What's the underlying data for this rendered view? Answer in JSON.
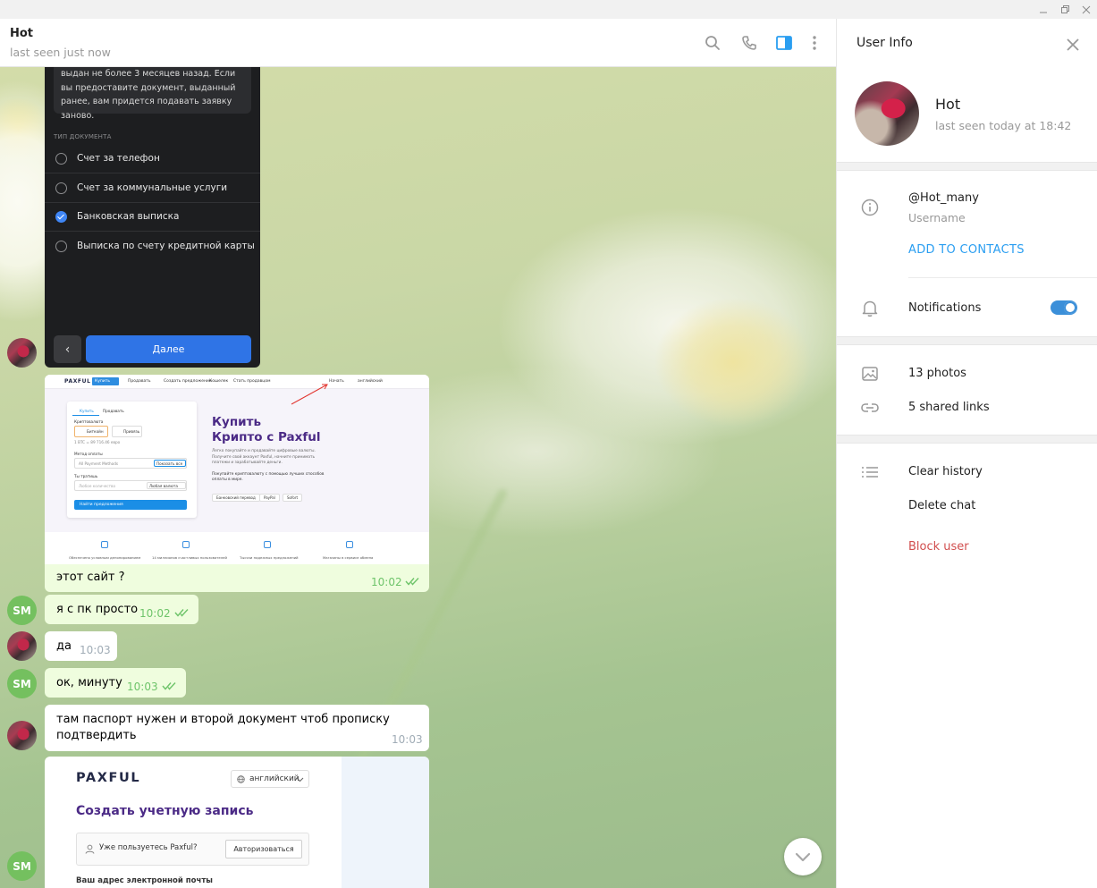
{
  "header": {
    "chat_title": "Hot",
    "chat_status": "last seen just now"
  },
  "dark_form": {
    "notice": "выдан не более 3 месяцев назад. Если вы предоставите документ, выданный ранее, вам придется подавать заявку заново.",
    "section_label": "ТИП ДОКУМЕНТА",
    "options": [
      {
        "label": "Счет за телефон",
        "selected": false
      },
      {
        "label": "Счет за коммунальные услуги",
        "selected": false
      },
      {
        "label": "Банковская выписка",
        "selected": true
      },
      {
        "label": "Выписка по счету кредитной карты",
        "selected": false
      }
    ],
    "back_glyph": "‹",
    "next_label": "Далее"
  },
  "paxful_landing": {
    "logo": "PAXFUL",
    "nav": {
      "buy": "Купить",
      "sell": "Продавать",
      "create_offer": "Создать предложение",
      "wallet": "Кошелек",
      "become_seller": "Стать продавцом",
      "start": "Начать",
      "lang": "английский"
    },
    "card": {
      "tab_buy": "Купить",
      "tab_sell": "Продавать",
      "crypto_label": "Криптовалюта",
      "coin_btc": "Биткойн",
      "coin_usdt": "Привязь",
      "rate": "1 BTC = 89 716.46 евро",
      "method_label": "Метод оплаты",
      "method_value": "All Payment Methods",
      "show_all": "Показать все",
      "amount_label": "Ты тратишь",
      "amount_placeholder": "Любое количество",
      "currency": "Любая валюта",
      "find_btn": "Найти предложения"
    },
    "headline_1": "Купить",
    "headline_2": "Крипто с Paxful",
    "desc": "Легко покупайте и продавайте цифровые валюты. Получите свой аккаунт Paxful, начните принимать платежи и зарабатывайте деньги.",
    "desc2": "Покупайте криптовалюту с помощью лучших способов оплаты в мире.",
    "tags": [
      "Банковский перевод",
      "PayPal",
      "Sofort"
    ],
    "features": [
      "Обеспечено условным депонированием",
      "14 миллионов счастливых пользователей",
      "Тысячи надежных предложений",
      "Магазины в сервисе обмена"
    ]
  },
  "messages": [
    {
      "text": "этот сайт ?",
      "time": "10:02"
    },
    {
      "text": "я с пк просто",
      "time": "10:02"
    },
    {
      "text": "да",
      "time": "10:03"
    },
    {
      "text": "ок, минуту",
      "time": "10:03"
    },
    {
      "text_line1": "там паспорт нужен и второй документ чтоб прописку",
      "text_line2": "подтвердить",
      "time": "10:03"
    }
  ],
  "avatars": {
    "self_initials": "SM"
  },
  "paxful_signup": {
    "logo": "PAXFUL",
    "lang": "английский",
    "title": "Создать учетную запись",
    "question": "Уже пользуетесь Paxful?",
    "auth_btn": "Авторизоваться",
    "email_label": "Ваш адрес электронной почты"
  },
  "panel": {
    "title": "User Info",
    "name": "Hot",
    "status": "last seen today at 18:42",
    "username": "@Hot_many",
    "username_label": "Username",
    "add_contacts": "ADD TO CONTACTS",
    "notifications": "Notifications",
    "notifications_on": true,
    "photos": "13 photos",
    "links": "5 shared links",
    "clear_history": "Clear history",
    "delete_chat": "Delete chat",
    "block_user": "Block user"
  },
  "colors": {
    "accent": "#2a9ef1",
    "outgoing_bubble": "#effdde",
    "time_out": "#6ec46a",
    "danger": "#d14e4e",
    "avatar_green": "#74c05f"
  },
  "icons": {
    "search": "search-icon",
    "call": "phone-icon",
    "panel": "sidebar-panel-icon",
    "more": "more-vertical-icon",
    "close": "close-icon",
    "info": "info-icon",
    "bell": "bell-icon",
    "photo": "photo-icon",
    "link": "link-icon",
    "list": "list-icon",
    "chevron_down": "chevron-down-icon"
  }
}
